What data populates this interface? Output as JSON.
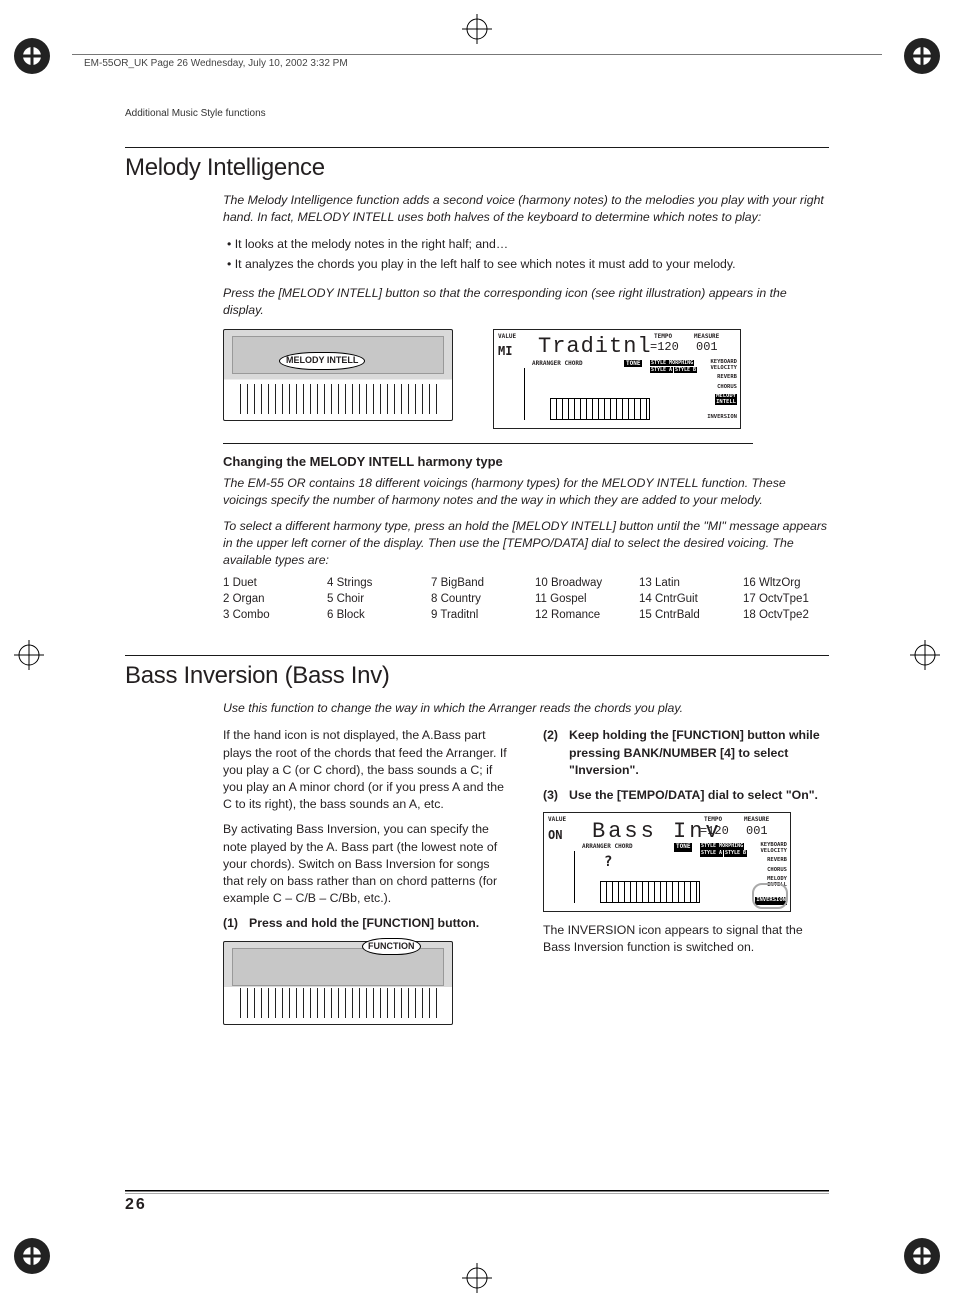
{
  "doc_header": "EM-55OR_UK  Page 26  Wednesday, July 10, 2002  3:32 PM",
  "running_head": "Additional Music Style functions",
  "page_number": "26",
  "section1": {
    "title": "Melody Intelligence",
    "intro": "The Melody Intelligence function adds a second voice (harmony notes) to the melodies you play with your right hand. In fact, MELODY INTELL uses both halves of the keyboard to determine which notes to play:",
    "bullet1": "It looks at the melody notes in the right half; and…",
    "bullet2": "It analyzes the chords you play in the left half to see which notes it must add to your melody.",
    "press": "Press the [MELODY INTELL] button so that the corresponding icon (see right illustration) appears in the display.",
    "callout": "MELODY INTELL",
    "lcd": {
      "value_label": "VALUE",
      "mi": "MI",
      "main": "Traditnl",
      "tempo_label": "TEMPO",
      "tempo": "120",
      "measure_label": "MEASURE",
      "measure": "001",
      "arranger": "ARRANGER CHORD",
      "tone": "TONE",
      "sm": "STYLE MORPHING",
      "sa": "STYLE A",
      "sb": "STYLE B",
      "kv": "KEYBOARD VELOCITY",
      "reverb": "REVERB",
      "chorus": "CHORUS",
      "mi2": "MELODY INTELL",
      "inv": "INVERSION"
    },
    "sub_h": "Changing the MELODY INTELL harmony type",
    "sub_p1": "The EM-55 OR contains 18 different voicings (harmony types) for the MELODY INTELL function. These voicings specify the number of harmony notes and the way in which they are added to your melody.",
    "sub_p2": "To select a different harmony type, press an hold the [MELODY INTELL] button until the \"MI\" message appears in the upper left corner of the display. Then use the [TEMPO/DATA] dial to select the desired voicing. The available types are:",
    "voices": [
      "1 Duet",
      "4 Strings",
      "7 BigBand",
      "10 Broadway",
      "13 Latin",
      "16 WltzOrg",
      "2 Organ",
      "5 Choir",
      "8 Country",
      "11 Gospel",
      "14 CntrGuit",
      "17 OctvTpe1",
      "3 Combo",
      "6 Block",
      "9 Traditnl",
      "12 Romance",
      "15 CntrBald",
      "18 OctvTpe2"
    ]
  },
  "section2": {
    "title": "Bass Inversion (Bass Inv)",
    "intro": "Use this function to change the way in which the Arranger reads the chords you play.",
    "left_p1": "If the hand icon is not displayed, the A.Bass part plays the root of the chords that feed the Arranger. If you play a C (or C chord), the bass sounds a C; if you play an A minor chord (or if you press A and the C to its right), the bass sounds an A, etc.",
    "left_p2": "By activating Bass Inversion, you can specify the note played by the A. Bass part (the lowest note of your chords). Switch on Bass Inversion for songs that rely on bass rather than on chord patterns (for example C – C/B – C/Bb, etc.).",
    "step1_n": "(1)",
    "step1": "Press and hold the [FUNCTION] button.",
    "callout": "FUNCTION",
    "step2_n": "(2)",
    "step2": "Keep holding the [FUNCTION] button while pressing BANK/NUMBER [4] to select \"Inversion\".",
    "step3_n": "(3)",
    "step3": "Use the [TEMPO/DATA] dial to select \"On\".",
    "lcd": {
      "value_label": "VALUE",
      "on": "ON",
      "main": "Bass Inv",
      "tempo_label": "TEMPO",
      "tempo": "120",
      "measure_label": "MEASURE",
      "measure": "001",
      "arranger": "ARRANGER CHORD",
      "chord": "?",
      "tone": "TONE",
      "sm": "STYLE MORPHING",
      "sa": "STYLE A",
      "sb": "STYLE B",
      "kv": "KEYBOARD VELOCITY",
      "reverb": "REVERB",
      "chorus": "CHORUS",
      "mi2": "MELODY INTELL",
      "inv": "INVERSION"
    },
    "after": "The INVERSION icon appears to signal that the Bass Inversion function is switched on."
  }
}
